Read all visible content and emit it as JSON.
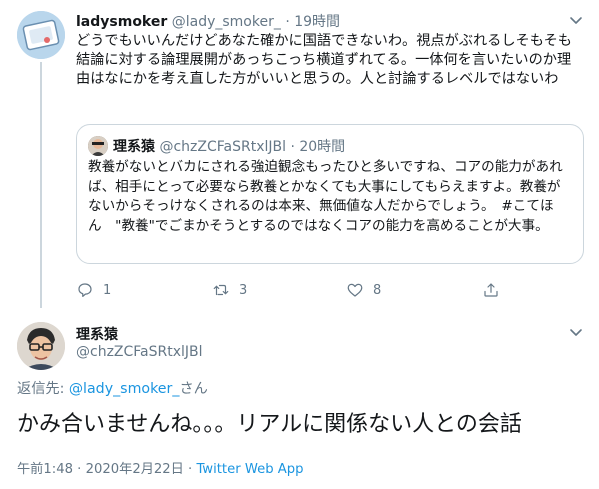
{
  "parent_tweet": {
    "name": "ladysmoker",
    "handle": "@lady_smoker_",
    "separator": "·",
    "time": "19時間",
    "text": "どうでもいいんだけどあなた確かに国語できないわ。視点がぶれるしそもそも結論に対する論理展開があっちこっち横道ずれてる。一体何を言いたいのか理由はなにかを考え直した方がいいと思うの。人と討論するレベルではないわ",
    "quote": {
      "name": "理系猿",
      "handle": "@chzZCFaSRtxlJBl",
      "separator": "·",
      "time": "20時間",
      "text": "教養がないとバカにされる強迫観念もったひと多いですね、コアの能力があれば、相手にとって必要なら教養とかなくても大事にしてもらえますよ。教養がないからそっけなくされるのは本来、無価値な人だからでしょう。　#こてほん　\"教養\"でごまかそうとするのではなくコアの能力を高めることが大事。"
    },
    "actions": {
      "reply_count": "1",
      "retweet_count": "3",
      "like_count": "8"
    }
  },
  "main_tweet": {
    "name": "理系猿",
    "handle": "@chzZCFaSRtxlJBl",
    "reply_prefix": "返信先: ",
    "reply_mention": "@lady_smoker_",
    "reply_suffix": "さん",
    "text": "かみ合いませんね。。。リアルに関係ない人との会話",
    "timestamp": "午前1:48 · 2020年2月22日 · ",
    "source": "Twitter Web App"
  },
  "colors": {
    "link": "#1b95e0",
    "secondary_text": "#657786",
    "border": "#ccd6dd"
  },
  "icons": {
    "reply": "reply-icon",
    "retweet": "retweet-icon",
    "like": "heart-icon",
    "share": "share-icon",
    "more": "chevron-down-icon"
  }
}
